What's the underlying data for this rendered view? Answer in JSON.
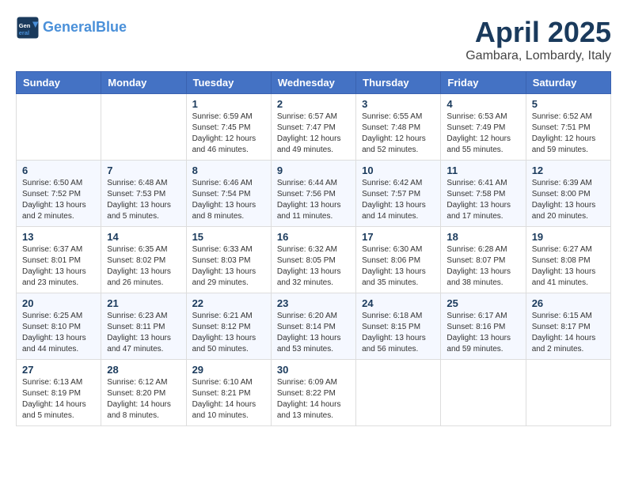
{
  "logo": {
    "line1": "General",
    "line2": "Blue"
  },
  "title": "April 2025",
  "location": "Gambara, Lombardy, Italy",
  "weekdays": [
    "Sunday",
    "Monday",
    "Tuesday",
    "Wednesday",
    "Thursday",
    "Friday",
    "Saturday"
  ],
  "weeks": [
    [
      {
        "day": "",
        "info": ""
      },
      {
        "day": "",
        "info": ""
      },
      {
        "day": "1",
        "info": "Sunrise: 6:59 AM\nSunset: 7:45 PM\nDaylight: 12 hours and 46 minutes."
      },
      {
        "day": "2",
        "info": "Sunrise: 6:57 AM\nSunset: 7:47 PM\nDaylight: 12 hours and 49 minutes."
      },
      {
        "day": "3",
        "info": "Sunrise: 6:55 AM\nSunset: 7:48 PM\nDaylight: 12 hours and 52 minutes."
      },
      {
        "day": "4",
        "info": "Sunrise: 6:53 AM\nSunset: 7:49 PM\nDaylight: 12 hours and 55 minutes."
      },
      {
        "day": "5",
        "info": "Sunrise: 6:52 AM\nSunset: 7:51 PM\nDaylight: 12 hours and 59 minutes."
      }
    ],
    [
      {
        "day": "6",
        "info": "Sunrise: 6:50 AM\nSunset: 7:52 PM\nDaylight: 13 hours and 2 minutes."
      },
      {
        "day": "7",
        "info": "Sunrise: 6:48 AM\nSunset: 7:53 PM\nDaylight: 13 hours and 5 minutes."
      },
      {
        "day": "8",
        "info": "Sunrise: 6:46 AM\nSunset: 7:54 PM\nDaylight: 13 hours and 8 minutes."
      },
      {
        "day": "9",
        "info": "Sunrise: 6:44 AM\nSunset: 7:56 PM\nDaylight: 13 hours and 11 minutes."
      },
      {
        "day": "10",
        "info": "Sunrise: 6:42 AM\nSunset: 7:57 PM\nDaylight: 13 hours and 14 minutes."
      },
      {
        "day": "11",
        "info": "Sunrise: 6:41 AM\nSunset: 7:58 PM\nDaylight: 13 hours and 17 minutes."
      },
      {
        "day": "12",
        "info": "Sunrise: 6:39 AM\nSunset: 8:00 PM\nDaylight: 13 hours and 20 minutes."
      }
    ],
    [
      {
        "day": "13",
        "info": "Sunrise: 6:37 AM\nSunset: 8:01 PM\nDaylight: 13 hours and 23 minutes."
      },
      {
        "day": "14",
        "info": "Sunrise: 6:35 AM\nSunset: 8:02 PM\nDaylight: 13 hours and 26 minutes."
      },
      {
        "day": "15",
        "info": "Sunrise: 6:33 AM\nSunset: 8:03 PM\nDaylight: 13 hours and 29 minutes."
      },
      {
        "day": "16",
        "info": "Sunrise: 6:32 AM\nSunset: 8:05 PM\nDaylight: 13 hours and 32 minutes."
      },
      {
        "day": "17",
        "info": "Sunrise: 6:30 AM\nSunset: 8:06 PM\nDaylight: 13 hours and 35 minutes."
      },
      {
        "day": "18",
        "info": "Sunrise: 6:28 AM\nSunset: 8:07 PM\nDaylight: 13 hours and 38 minutes."
      },
      {
        "day": "19",
        "info": "Sunrise: 6:27 AM\nSunset: 8:08 PM\nDaylight: 13 hours and 41 minutes."
      }
    ],
    [
      {
        "day": "20",
        "info": "Sunrise: 6:25 AM\nSunset: 8:10 PM\nDaylight: 13 hours and 44 minutes."
      },
      {
        "day": "21",
        "info": "Sunrise: 6:23 AM\nSunset: 8:11 PM\nDaylight: 13 hours and 47 minutes."
      },
      {
        "day": "22",
        "info": "Sunrise: 6:21 AM\nSunset: 8:12 PM\nDaylight: 13 hours and 50 minutes."
      },
      {
        "day": "23",
        "info": "Sunrise: 6:20 AM\nSunset: 8:14 PM\nDaylight: 13 hours and 53 minutes."
      },
      {
        "day": "24",
        "info": "Sunrise: 6:18 AM\nSunset: 8:15 PM\nDaylight: 13 hours and 56 minutes."
      },
      {
        "day": "25",
        "info": "Sunrise: 6:17 AM\nSunset: 8:16 PM\nDaylight: 13 hours and 59 minutes."
      },
      {
        "day": "26",
        "info": "Sunrise: 6:15 AM\nSunset: 8:17 PM\nDaylight: 14 hours and 2 minutes."
      }
    ],
    [
      {
        "day": "27",
        "info": "Sunrise: 6:13 AM\nSunset: 8:19 PM\nDaylight: 14 hours and 5 minutes."
      },
      {
        "day": "28",
        "info": "Sunrise: 6:12 AM\nSunset: 8:20 PM\nDaylight: 14 hours and 8 minutes."
      },
      {
        "day": "29",
        "info": "Sunrise: 6:10 AM\nSunset: 8:21 PM\nDaylight: 14 hours and 10 minutes."
      },
      {
        "day": "30",
        "info": "Sunrise: 6:09 AM\nSunset: 8:22 PM\nDaylight: 14 hours and 13 minutes."
      },
      {
        "day": "",
        "info": ""
      },
      {
        "day": "",
        "info": ""
      },
      {
        "day": "",
        "info": ""
      }
    ]
  ]
}
